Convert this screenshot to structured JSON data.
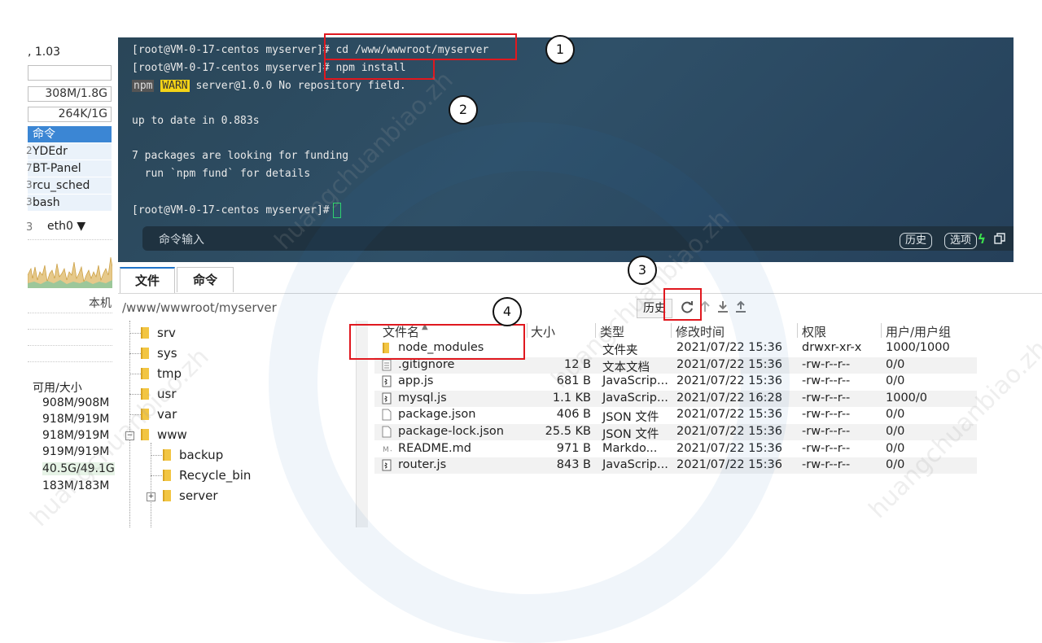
{
  "left_panel": {
    "load_value": ", 1.03",
    "mem_value": "308M/1.8G",
    "swap_value": "264K/1G",
    "process_header": "命令",
    "processes": [
      "YDEdr",
      "BT-Panel",
      "rcu_sched",
      "bash"
    ],
    "process_prefixes": [
      "2",
      "7",
      "3",
      "3"
    ],
    "net_prefix": "3",
    "net_interface": "eth0 ▼",
    "local_label": "本机",
    "disk_header": "可用/大小",
    "disks": [
      "908M/908M",
      "918M/919M",
      "918M/919M",
      "919M/919M",
      "40.5G/49.1G",
      "183M/183M"
    ]
  },
  "terminal": {
    "lines": [
      {
        "prompt": "[root@VM-0-17-centos myserver]#",
        "cmd": " cd /www/wwwroot/myserver"
      },
      {
        "prompt": "[root@VM-0-17-centos myserver]#",
        "cmd": " npm install"
      }
    ],
    "npm_tag": "npm",
    "warn_tag": "WARN",
    "warn_text": " server@1.0.0 No repository field.",
    "uptodate": "up to date in 0.883s",
    "funding1": "7 packages are looking for funding",
    "funding2": "  run `npm fund` for details",
    "last_prompt": "[root@VM-0-17-centos myserver]#",
    "input_placeholder": "命令输入",
    "history_btn": "历史",
    "options_btn": "选项"
  },
  "tabs": [
    {
      "label": "文件",
      "active": true
    },
    {
      "label": "命令",
      "active": false
    }
  ],
  "path": "/www/wwwroot/myserver",
  "toolbar": {
    "history_label": "历史"
  },
  "tree": {
    "items": [
      "srv",
      "sys",
      "tmp",
      "usr",
      "var",
      "www",
      "backup",
      "Recycle_bin",
      "server"
    ]
  },
  "file_table": {
    "headers": [
      "文件名",
      "大小",
      "类型",
      "修改时间",
      "权限",
      "用户/用户组"
    ],
    "rows": [
      {
        "name": "node_modules",
        "size": "",
        "type": "文件夹",
        "mtime": "2021/07/22 15:36",
        "perm": "drwxr-xr-x",
        "owner": "1000/1000",
        "icon": "folder-icon"
      },
      {
        "name": ".gitignore",
        "size": "12 B",
        "type": "文本文档",
        "mtime": "2021/07/22 15:36",
        "perm": "-rw-r--r--",
        "owner": "0/0",
        "icon": "text-file-icon"
      },
      {
        "name": "app.js",
        "size": "681 B",
        "type": "JavaScrip...",
        "mtime": "2021/07/22 15:36",
        "perm": "-rw-r--r--",
        "owner": "0/0",
        "icon": "script-file-icon"
      },
      {
        "name": "mysql.js",
        "size": "1.1 KB",
        "type": "JavaScrip...",
        "mtime": "2021/07/22 16:28",
        "perm": "-rw-r--r--",
        "owner": "1000/0",
        "icon": "script-file-icon"
      },
      {
        "name": "package.json",
        "size": "406 B",
        "type": "JSON 文件",
        "mtime": "2021/07/22 15:36",
        "perm": "-rw-r--r--",
        "owner": "0/0",
        "icon": "blank-file-icon"
      },
      {
        "name": "package-lock.json",
        "size": "25.5 KB",
        "type": "JSON 文件",
        "mtime": "2021/07/22 15:36",
        "perm": "-rw-r--r--",
        "owner": "0/0",
        "icon": "blank-file-icon"
      },
      {
        "name": "README.md",
        "size": "971 B",
        "type": "Markdo...",
        "mtime": "2021/07/22 15:36",
        "perm": "-rw-r--r--",
        "owner": "0/0",
        "icon": "markdown-file-icon"
      },
      {
        "name": "router.js",
        "size": "843 B",
        "type": "JavaScrip...",
        "mtime": "2021/07/22 15:36",
        "perm": "-rw-r--r--",
        "owner": "0/0",
        "icon": "script-file-icon"
      }
    ]
  },
  "annotations": [
    "1",
    "2",
    "3",
    "4"
  ],
  "watermark": "huangchuanbiao.zh"
}
